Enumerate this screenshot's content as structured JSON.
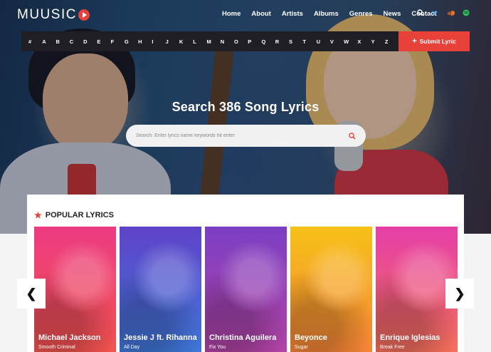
{
  "header": {
    "logo_text": "MUUSIC",
    "nav": [
      "Home",
      "About",
      "Artists",
      "Albums",
      "Genres",
      "News",
      "Contact"
    ],
    "icons": [
      "search-icon",
      "twitter-icon",
      "soundcloud-icon",
      "spotify-icon"
    ]
  },
  "alphabet": [
    "#",
    "A",
    "B",
    "C",
    "D",
    "E",
    "F",
    "G",
    "H",
    "I",
    "J",
    "K",
    "L",
    "M",
    "N",
    "O",
    "P",
    "Q",
    "R",
    "S",
    "T",
    "U",
    "V",
    "W",
    "X",
    "Y",
    "Z"
  ],
  "submit": {
    "label": "Submit Lyric"
  },
  "search": {
    "title": "Search 386 Song Lyrics",
    "placeholder": "Search: Enter lyrics name keywords hit enter"
  },
  "popular": {
    "title": "POPULAR LYRICS",
    "cards": [
      {
        "artist": "Michael Jackson",
        "song": "Smooth Criminal",
        "colors": [
          "#ec3b82",
          "#f2534e"
        ]
      },
      {
        "artist": "Jessie J ft. Rihanna",
        "song": "All Day",
        "colors": [
          "#5f42c8",
          "#3f78d9"
        ]
      },
      {
        "artist": "Christina Aguilera",
        "song": "Fix You",
        "colors": [
          "#7b3fc4",
          "#b344a6"
        ]
      },
      {
        "artist": "Beyonce",
        "song": "Sugar",
        "colors": [
          "#f7c218",
          "#f58437"
        ]
      },
      {
        "artist": "Enrique Iglesias",
        "song": "Break Free",
        "colors": [
          "#e53ea8",
          "#f5705a"
        ]
      }
    ]
  },
  "colors": {
    "accent": "#e8413a",
    "bar": "#1e1e24"
  }
}
